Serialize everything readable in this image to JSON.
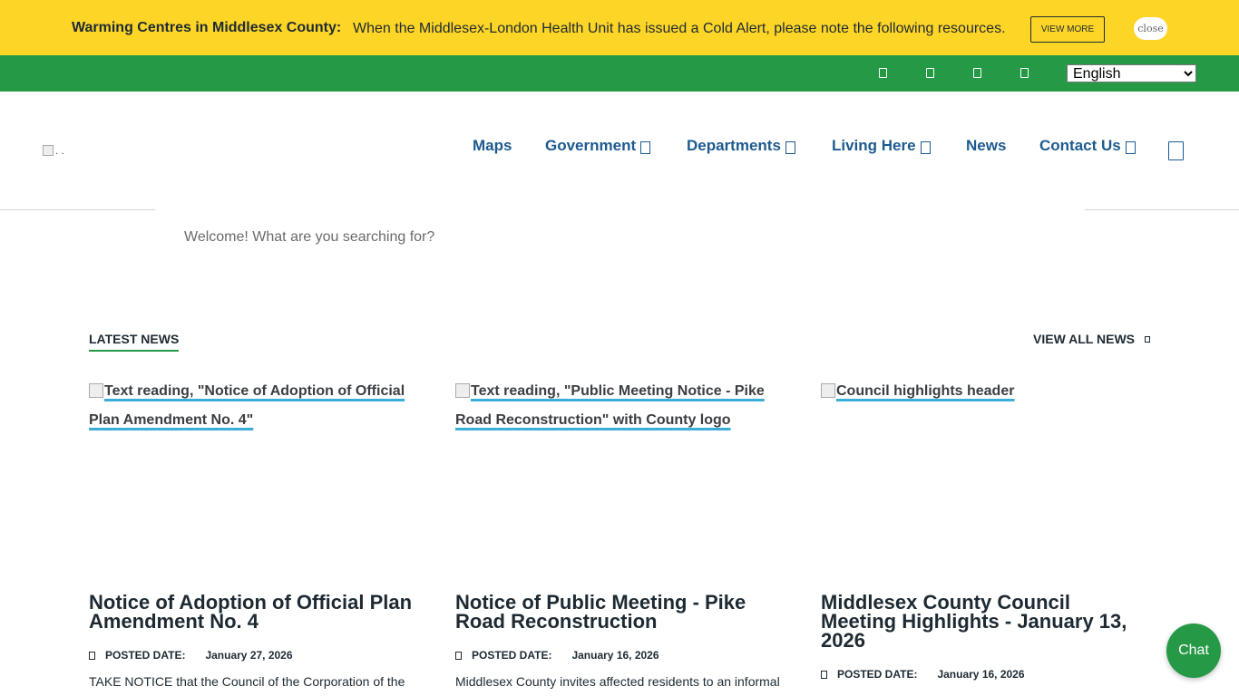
{
  "alert": {
    "title": "Warming Centres in Middlesex County:",
    "message": "When the Middlesex-London Health Unit has issued a Cold Alert, please note the following resources.",
    "view_more_label": "VIEW MORE",
    "close_label": "close"
  },
  "utility": {
    "icons": [
      "facebook-icon",
      "twitter-icon",
      "instagram-icon",
      "youtube-icon"
    ],
    "language": {
      "selected": "English",
      "options": [
        "English"
      ]
    }
  },
  "header": {
    "logo_alt": ". .",
    "nav": [
      {
        "label": "Maps",
        "dropdown": false
      },
      {
        "label": "Government",
        "dropdown": true
      },
      {
        "label": "Departments",
        "dropdown": true
      },
      {
        "label": "Living Here",
        "dropdown": true
      },
      {
        "label": "News",
        "dropdown": false
      },
      {
        "label": "Contact Us",
        "dropdown": true
      }
    ],
    "search_placeholder": "Welcome! What are you searching for?"
  },
  "news": {
    "heading": "LATEST NEWS",
    "view_all_label": "VIEW ALL NEWS",
    "posted_label": "POSTED DATE:",
    "items": [
      {
        "image_alt": "Text reading, \"Notice of Adoption of Official Plan Amendment No. 4\"",
        "title": "Notice of Adoption of Official Plan Amendment No. 4",
        "date": "January 27, 2026",
        "excerpt": "TAKE NOTICE that the Council of the Corporation of the"
      },
      {
        "image_alt": "Text reading, \"Public Meeting Notice - Pike Road Reconstruction\" with County logo",
        "title": "Notice of Public Meeting - Pike Road Reconstruction",
        "date": "January 16, 2026",
        "excerpt": "Middlesex County invites affected residents to an informal"
      },
      {
        "image_alt": "Council highlights header",
        "title": "Middlesex County Council Meeting Highlights - January 13, 2026",
        "date": "January 16, 2026",
        "excerpt": ""
      }
    ]
  },
  "chat": {
    "label": "Chat"
  },
  "colors": {
    "alert_yellow": "#fdd526",
    "brand_green": "#259946",
    "nav_blue": "#1d5a8f",
    "link_underline": "#3aaed8"
  }
}
